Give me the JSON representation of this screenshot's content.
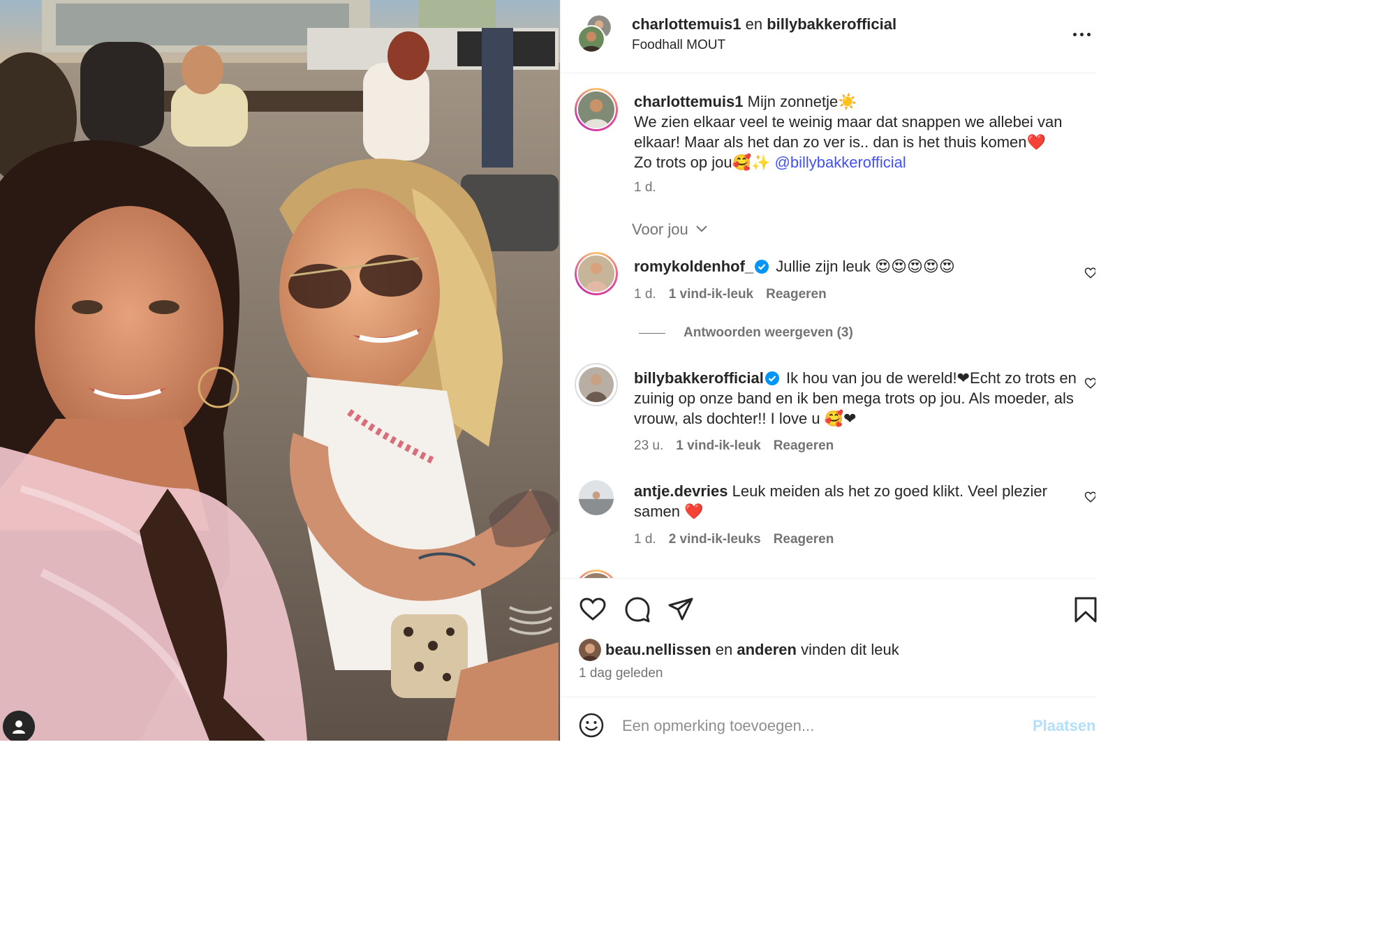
{
  "header": {
    "user1": "charlottemuis1",
    "conjunction": "en",
    "user2": "billybakkerofficial",
    "location": "Foodhall MOUT"
  },
  "caption": {
    "username": "charlottemuis1",
    "line1": "Mijn zonnetje☀️",
    "line2": "We zien elkaar veel te weinig maar dat snappen we allebei van elkaar! Maar als het dan zo ver is.. dan is het thuis komen❤️",
    "line3": "Zo trots op jou🥰✨",
    "mention": "@billybakkerofficial",
    "time": "1 d."
  },
  "section_label": "Voor jou",
  "comments": [
    {
      "username": "romykoldenhof_",
      "verified": true,
      "text": "Jullie zijn leuk 😍😍😍😍😍",
      "time": "1 d.",
      "likes": "1 vind-ik-leuk",
      "reply": "Reageren"
    },
    {
      "username": "billybakkerofficial",
      "verified": true,
      "text": "Ik hou van jou de wereld!❤Echt zo trots en zuinig op onze band en ik ben mega trots op jou. Als moeder, als vrouw, als dochter!! I love u 🥰❤",
      "time": "23 u.",
      "likes": "1 vind-ik-leuk",
      "reply": "Reageren"
    },
    {
      "username": "antje.devries",
      "verified": false,
      "text": "Leuk meiden als het zo goed klikt. Veel plezier samen ❤️",
      "time": "1 d.",
      "likes": "2 vind-ik-leuks",
      "reply": "Reageren"
    }
  ],
  "view_replies": "Antwoorden weergeven (3)",
  "liked_by": {
    "user": "beau.nellissen",
    "conjunction": "en",
    "others": "anderen",
    "suffix": "vinden dit leuk"
  },
  "post_date": "1 dag geleden",
  "add_comment": {
    "placeholder": "Een opmerking toevoegen...",
    "post_label": "Plaatsen"
  },
  "icons": [
    "more-icon",
    "verified-icon",
    "heart-icon",
    "comment-icon",
    "share-icon",
    "bookmark-icon",
    "smiley-icon",
    "user-icon",
    "chevron-down-icon"
  ],
  "colors": {
    "accent": "#4150f7",
    "verified": "#0095f6",
    "muted": "#737373",
    "post_button": "#b2dffc"
  }
}
